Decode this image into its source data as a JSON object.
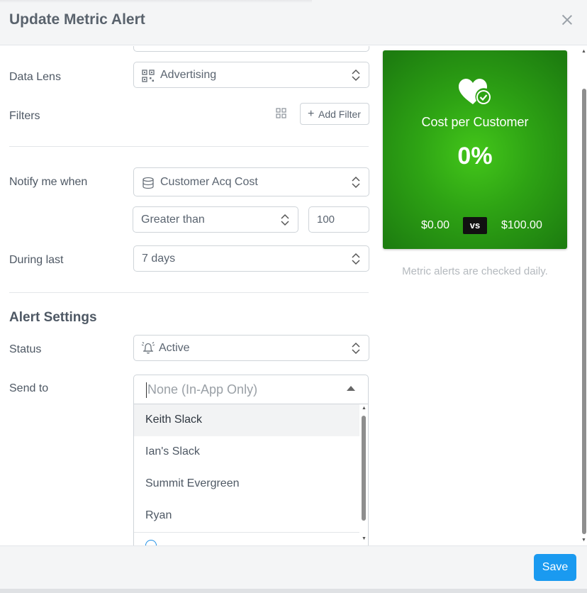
{
  "header": {
    "title": "Update Metric Alert"
  },
  "form": {
    "data_lens": {
      "label": "Data Lens",
      "value": "Advertising",
      "icon": "qr-grid-icon"
    },
    "filters": {
      "label": "Filters",
      "add_filter_label": "Add Filter"
    },
    "notify": {
      "label": "Notify me when",
      "metric": "Customer Acq Cost",
      "metric_icon": "database-icon",
      "operator": "Greater than",
      "threshold": "100"
    },
    "during": {
      "label": "During last",
      "value": "7 days"
    }
  },
  "alert_settings": {
    "title": "Alert Settings",
    "status": {
      "label": "Status",
      "value": "Active",
      "icon": "bell-icon"
    },
    "send_to": {
      "label": "Send to",
      "placeholder": "None (In-App Only)",
      "options": [
        "Keith Slack",
        "Ian's Slack",
        "Summit Evergreen",
        "Ryan"
      ],
      "highlighted_option": "Keith Slack"
    }
  },
  "card": {
    "title": "Cost per Customer",
    "value": "0%",
    "left_value": "$0.00",
    "vs_label": "vs",
    "right_value": "$100.00",
    "icon": "heart-check-icon",
    "note": "Metric alerts are checked daily.",
    "colors": {
      "center": "#43c61a",
      "edge": "#1d7d10"
    }
  },
  "footer": {
    "save_label": "Save"
  },
  "colors": {
    "accent": "#1a9af0"
  }
}
